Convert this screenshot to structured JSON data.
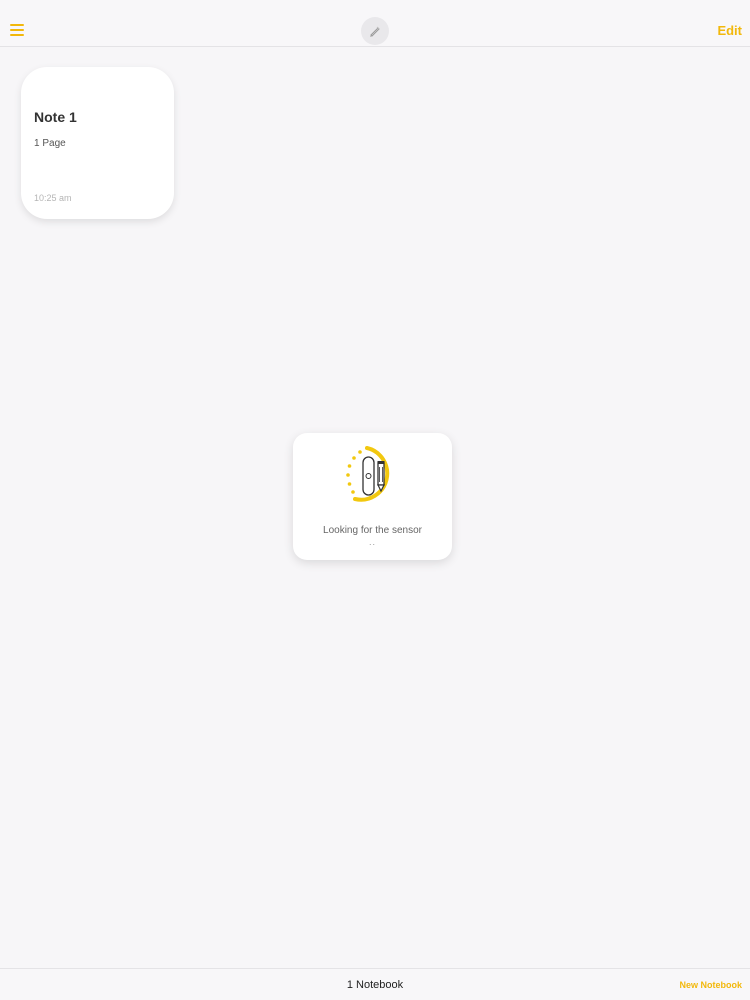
{
  "topbar": {
    "menu_icon": "hamburger-menu-icon",
    "pen_icon": "pen-icon",
    "edit_label": "Edit"
  },
  "note": {
    "title": "Note 1",
    "pages": "1 Page",
    "time": "10:25 am"
  },
  "sensor_dialog": {
    "icon": "sensor-pen-search-icon",
    "message": "Looking for the sensor",
    "progress_dots": ".."
  },
  "bottombar": {
    "notebook_count": "1 Notebook",
    "new_notebook_label": "New Notebook"
  },
  "colors": {
    "accent": "#f2b80c",
    "background": "#f7f6f8"
  }
}
